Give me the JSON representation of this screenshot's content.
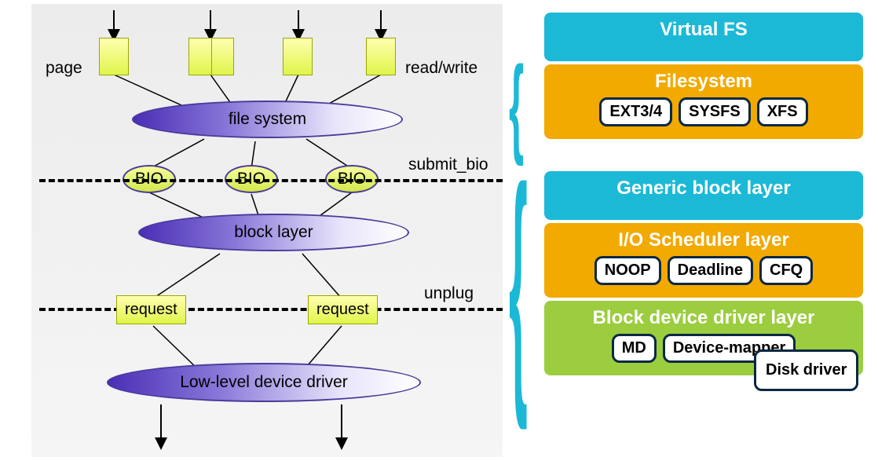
{
  "left": {
    "page_label": "page",
    "readwrite_label": "read/write",
    "filesystem_label": "file system",
    "bio_label": "BIO",
    "submit_bio_label": "submit_bio",
    "block_layer_label": "block layer",
    "request_label": "request",
    "unplug_label": "unplug",
    "lowlevel_label": "Low-level device driver"
  },
  "right": {
    "group1": {
      "vfs": "Virtual FS",
      "filesystem": "Filesystem",
      "fs_items": [
        "EXT3/4",
        "SYSFS",
        "XFS"
      ]
    },
    "group2": {
      "generic": "Generic block layer",
      "iosched": "I/O Scheduler layer",
      "iosched_items": [
        "NOOP",
        "Deadline",
        "CFQ"
      ],
      "driver": "Block device driver layer",
      "driver_items": [
        "MD",
        "Device-mapper",
        "Disk driver"
      ]
    }
  }
}
